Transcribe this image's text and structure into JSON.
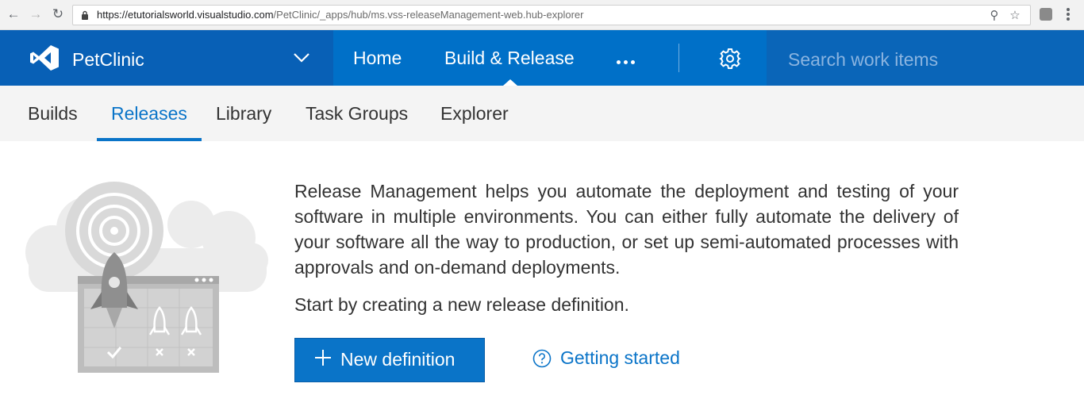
{
  "browser": {
    "url_host": "https://etutorialsworld.visualstudio.com",
    "url_path": "/PetClinic/_apps/hub/ms.vss-releaseManagement-web.hub-explorer"
  },
  "header": {
    "project_name": "PetClinic",
    "hubs": [
      {
        "label": "Home"
      },
      {
        "label": "Build & Release"
      }
    ],
    "search_placeholder": "Search work items"
  },
  "subnav": {
    "tabs": [
      {
        "label": "Builds"
      },
      {
        "label": "Releases"
      },
      {
        "label": "Library"
      },
      {
        "label": "Task Groups"
      },
      {
        "label": "Explorer"
      }
    ],
    "active": "Releases"
  },
  "main": {
    "description": "Release Management helps you automate the deployment and testing of your software in multiple environments. You can either fully automate the delivery of your software all the way to production, or set up semi-automated processes with approvals and on-demand deployments.",
    "start_text": "Start by creating a new release definition.",
    "new_definition_label": "New definition",
    "getting_started_label": "Getting started"
  },
  "colors": {
    "header_blue": "#0070c8",
    "accent_blue": "#0a74c8"
  }
}
